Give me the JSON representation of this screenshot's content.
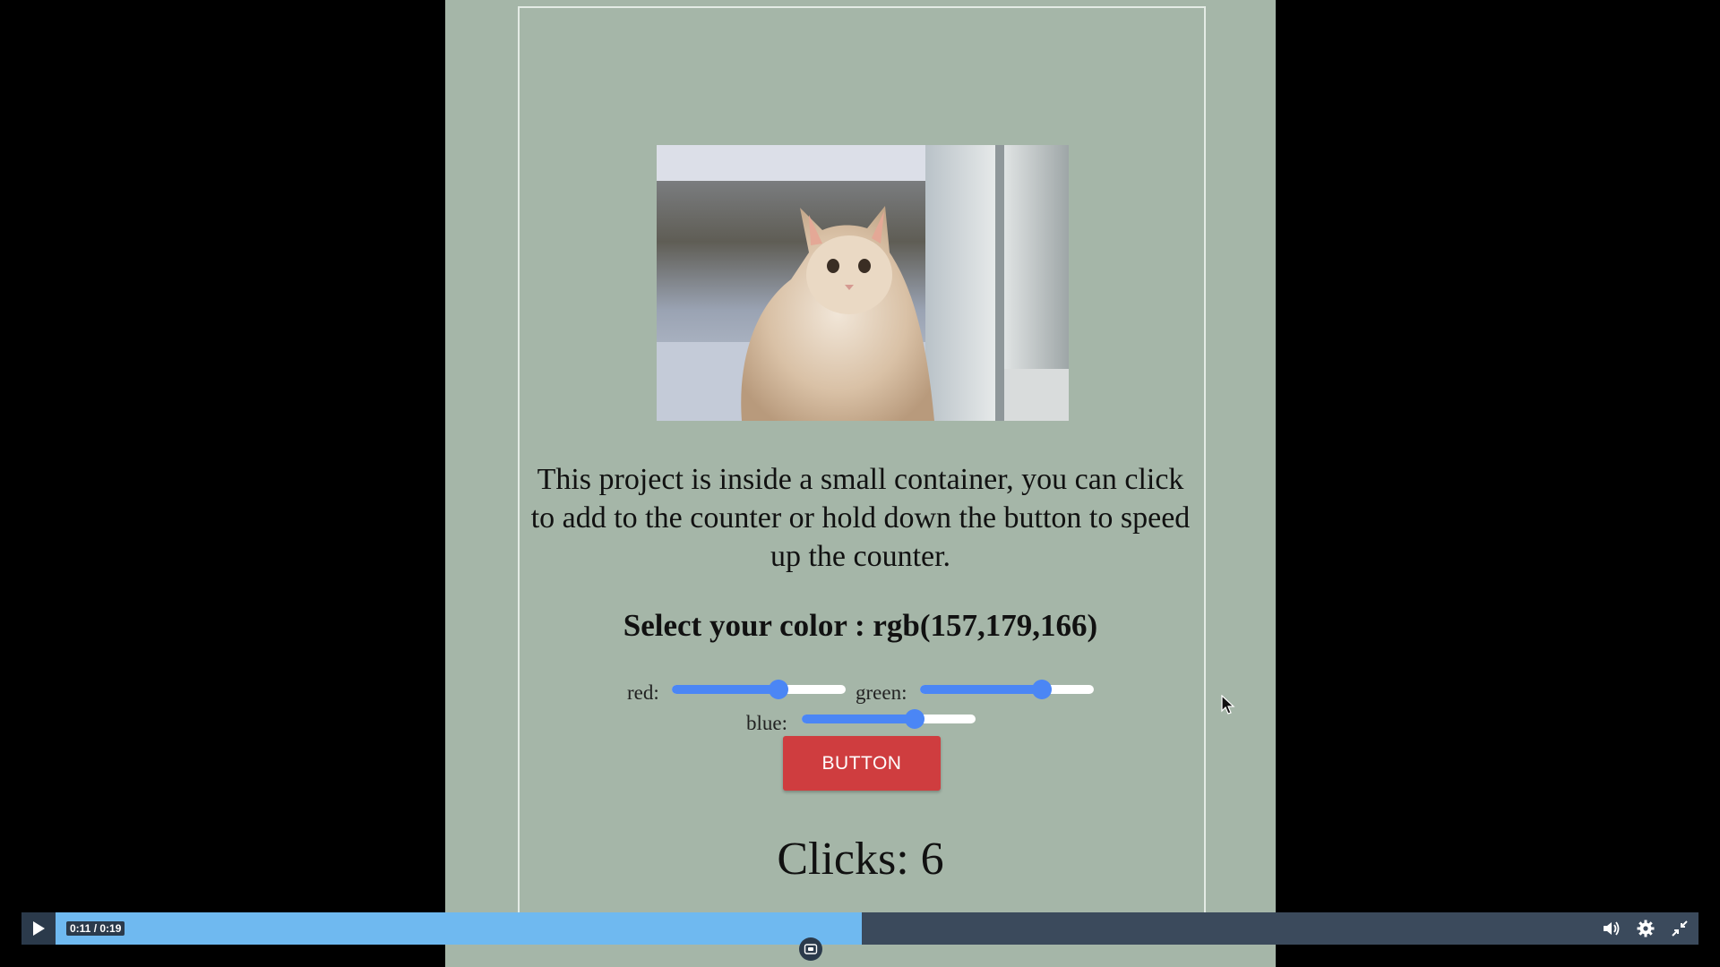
{
  "content": {
    "description": "This project is inside a small container, you can click to add to the counter or hold down the button to speed up the counter.",
    "color_heading": "Select your color : rgb(157,179,166)",
    "sliders": {
      "red": {
        "label": "red:",
        "value": 157,
        "max": 255
      },
      "green": {
        "label": "green:",
        "value": 179,
        "max": 255
      },
      "blue": {
        "label": "blue:",
        "value": 166,
        "max": 255
      }
    },
    "button_label": "BUTTON",
    "clicks_text": "Clicks: 6"
  },
  "player": {
    "time": "0:11 / 0:19",
    "progress": 0.579,
    "icons": [
      "play-icon",
      "volume-icon",
      "gear-icon",
      "exit-fullscreen-icon",
      "picture-in-picture-icon"
    ]
  },
  "colors": {
    "background": "#a5b6a8",
    "slider_accent": "#4b86f5",
    "button": "#cf3d3f",
    "progress": "#6fb9f0",
    "control_bar": "#3b4a5c"
  }
}
